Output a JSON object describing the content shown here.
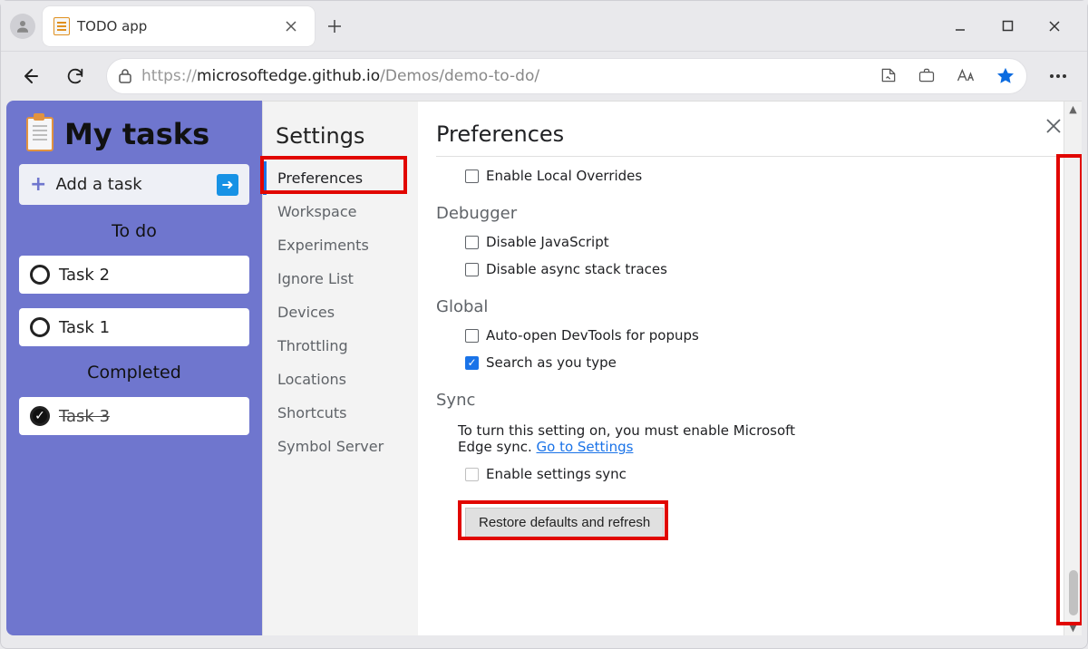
{
  "browser": {
    "tab_title": "TODO app",
    "url_protocol": "https://",
    "url_host": "microsoftedge.github.io",
    "url_path": "/Demos/demo-to-do/"
  },
  "app": {
    "title": "My tasks",
    "add_task_label": "Add a task",
    "sections": {
      "todo_label": "To do",
      "completed_label": "Completed"
    },
    "tasks_todo": [
      "Task 2",
      "Task 1"
    ],
    "tasks_done": [
      "Task 3"
    ]
  },
  "settings": {
    "title": "Settings",
    "items": [
      "Preferences",
      "Workspace",
      "Experiments",
      "Ignore List",
      "Devices",
      "Throttling",
      "Locations",
      "Shortcuts",
      "Symbol Server"
    ],
    "active_index": 0
  },
  "prefs": {
    "heading": "Preferences",
    "local_overrides": "Enable Local Overrides",
    "debugger_title": "Debugger",
    "disable_js": "Disable JavaScript",
    "disable_async": "Disable async stack traces",
    "global_title": "Global",
    "auto_open": "Auto-open DevTools for popups",
    "search_as_type": "Search as you type",
    "sync_title": "Sync",
    "sync_note_pre": "To turn this setting on, you must enable Microsoft Edge sync. ",
    "sync_link": "Go to Settings",
    "enable_sync": "Enable settings sync",
    "restore_button": "Restore defaults and refresh"
  }
}
